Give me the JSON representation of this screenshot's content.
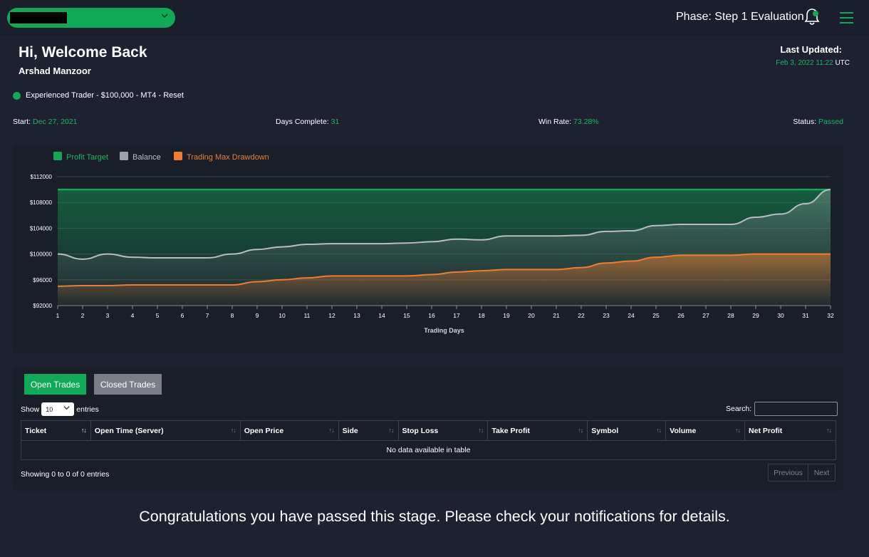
{
  "topbar": {
    "phase_text": "Phase: Step 1 Evaluation",
    "account_select_value": "",
    "icons": [
      "chevron-down-icon",
      "bell-icon",
      "hamburger-menu-icon"
    ]
  },
  "header": {
    "greeting": "Hi, Welcome Back",
    "user_name": "Arshad Manzoor",
    "last_updated_label": "Last Updated:",
    "last_updated_value": "Feb 3, 2022 11:22",
    "last_updated_tz": "UTC"
  },
  "account": {
    "description": "Experienced Trader - $100,000 - MT4 - Reset",
    "status_color": "#0fa958"
  },
  "stats": {
    "start_label": "Start:",
    "start_value": "Dec 27, 2021",
    "days_label": "Days Complete:",
    "days_value": "31",
    "winrate_label": "Win Rate:",
    "winrate_value": "73.28%",
    "status_label": "Status:",
    "status_value": "Passed"
  },
  "colors": {
    "accent_green": "#0fa958",
    "balance_gray": "#b9bdc3",
    "drawdown_orange": "#f07c2c"
  },
  "chart_data": {
    "type": "area",
    "title": "",
    "xlabel": "Trading Days",
    "ylabel": "",
    "x": [
      1,
      2,
      3,
      4,
      5,
      6,
      7,
      8,
      9,
      10,
      11,
      12,
      13,
      14,
      15,
      16,
      17,
      18,
      19,
      20,
      21,
      22,
      23,
      24,
      25,
      26,
      27,
      28,
      29,
      30,
      31,
      32
    ],
    "xlim": [
      1,
      32
    ],
    "ylim": [
      92000,
      112000
    ],
    "yticks": [
      92000,
      96000,
      100000,
      104000,
      108000,
      112000
    ],
    "ytick_labels": [
      "$92000",
      "$96000",
      "$100000",
      "$104000",
      "$108000",
      "$112000"
    ],
    "legend_position": "top-left",
    "grid": true,
    "series": [
      {
        "name": "Profit Target",
        "color": "#0fa958",
        "values": [
          110000,
          110000,
          110000,
          110000,
          110000,
          110000,
          110000,
          110000,
          110000,
          110000,
          110000,
          110000,
          110000,
          110000,
          110000,
          110000,
          110000,
          110000,
          110000,
          110000,
          110000,
          110000,
          110000,
          110000,
          110000,
          110000,
          110000,
          110000,
          110000,
          110000,
          110000,
          110000
        ]
      },
      {
        "name": "Balance",
        "color": "#b9bdc3",
        "values": [
          100000,
          99200,
          100000,
          99500,
          99400,
          99400,
          99400,
          100000,
          100700,
          101100,
          101500,
          101600,
          101600,
          101600,
          101700,
          101900,
          102300,
          102200,
          102800,
          102800,
          102800,
          102900,
          103500,
          103600,
          104400,
          104600,
          104600,
          104600,
          105700,
          106200,
          107800,
          110000
        ]
      },
      {
        "name": "Trading Max Drawdown",
        "color": "#f07c2c",
        "values": [
          95000,
          95100,
          95100,
          95200,
          95200,
          95200,
          95200,
          95200,
          95700,
          96000,
          96300,
          96600,
          96600,
          96600,
          96600,
          96800,
          97200,
          97400,
          97600,
          97600,
          97600,
          97900,
          98600,
          98900,
          99500,
          99800,
          99800,
          99800,
          100000,
          100000,
          100000,
          100000
        ]
      }
    ]
  },
  "trades": {
    "tab_open": "Open Trades",
    "tab_closed": "Closed Trades",
    "show_label": "Show",
    "entries_label": "entries",
    "page_length": "10",
    "search_label": "Search:",
    "search_value": "",
    "columns": [
      "Ticket",
      "Open Time (Server)",
      "Open Price",
      "Side",
      "Stop Loss",
      "Take Profit",
      "Symbol",
      "Volume",
      "Net Profit"
    ],
    "empty_message": "No data available in table",
    "info": "Showing 0 to 0 of 0 entries",
    "prev_label": "Previous",
    "next_label": "Next"
  },
  "footer": {
    "message": "Congratulations you have passed this stage. Please check your notifications for details."
  }
}
